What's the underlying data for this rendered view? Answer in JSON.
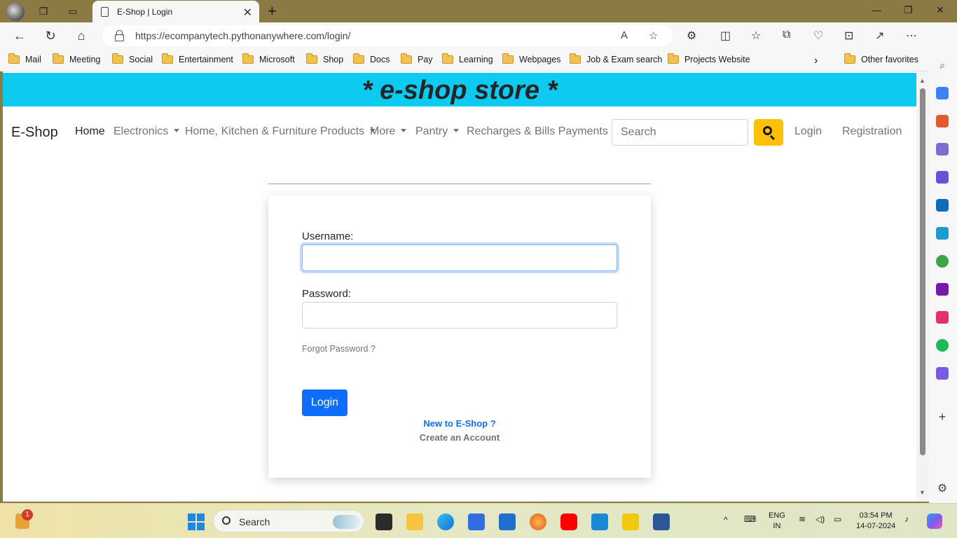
{
  "browser": {
    "tab_title": "E-Shop | Login",
    "url": "https://ecompanytech.pythonanywhere.com/login/",
    "favorites": [
      "Mail",
      "Meeting",
      "Social",
      "Entertainment",
      "Microsoft",
      "Shop",
      "Docs",
      "Pay",
      "Learning",
      "Webpages",
      "Job & Exam search",
      "Projects Website"
    ],
    "other_favorites": "Other favorites"
  },
  "site": {
    "banner": "* e-shop store *",
    "brand": "E-Shop",
    "nav": {
      "home": "Home",
      "electronics": "Electronics",
      "home_kitchen": "Home, Kitchen & Furniture Products",
      "more": "More",
      "pantry": "Pantry",
      "recharges": "Recharges & Bills Payments",
      "login": "Login",
      "registration": "Registration"
    },
    "search": {
      "placeholder": "Search"
    }
  },
  "login_form": {
    "username_label": "Username:",
    "username_value": "",
    "password_label": "Password:",
    "password_value": "",
    "forgot": "Forgot Password ?",
    "submit": "Login",
    "new_to": "New to E-Shop ?",
    "create": "Create an Account"
  },
  "taskbar": {
    "search_label": "Search",
    "notification_count": "1",
    "lang_top": "ENG",
    "lang_bottom": "IN",
    "time": "03:54 PM",
    "date": "14-07-2024"
  }
}
